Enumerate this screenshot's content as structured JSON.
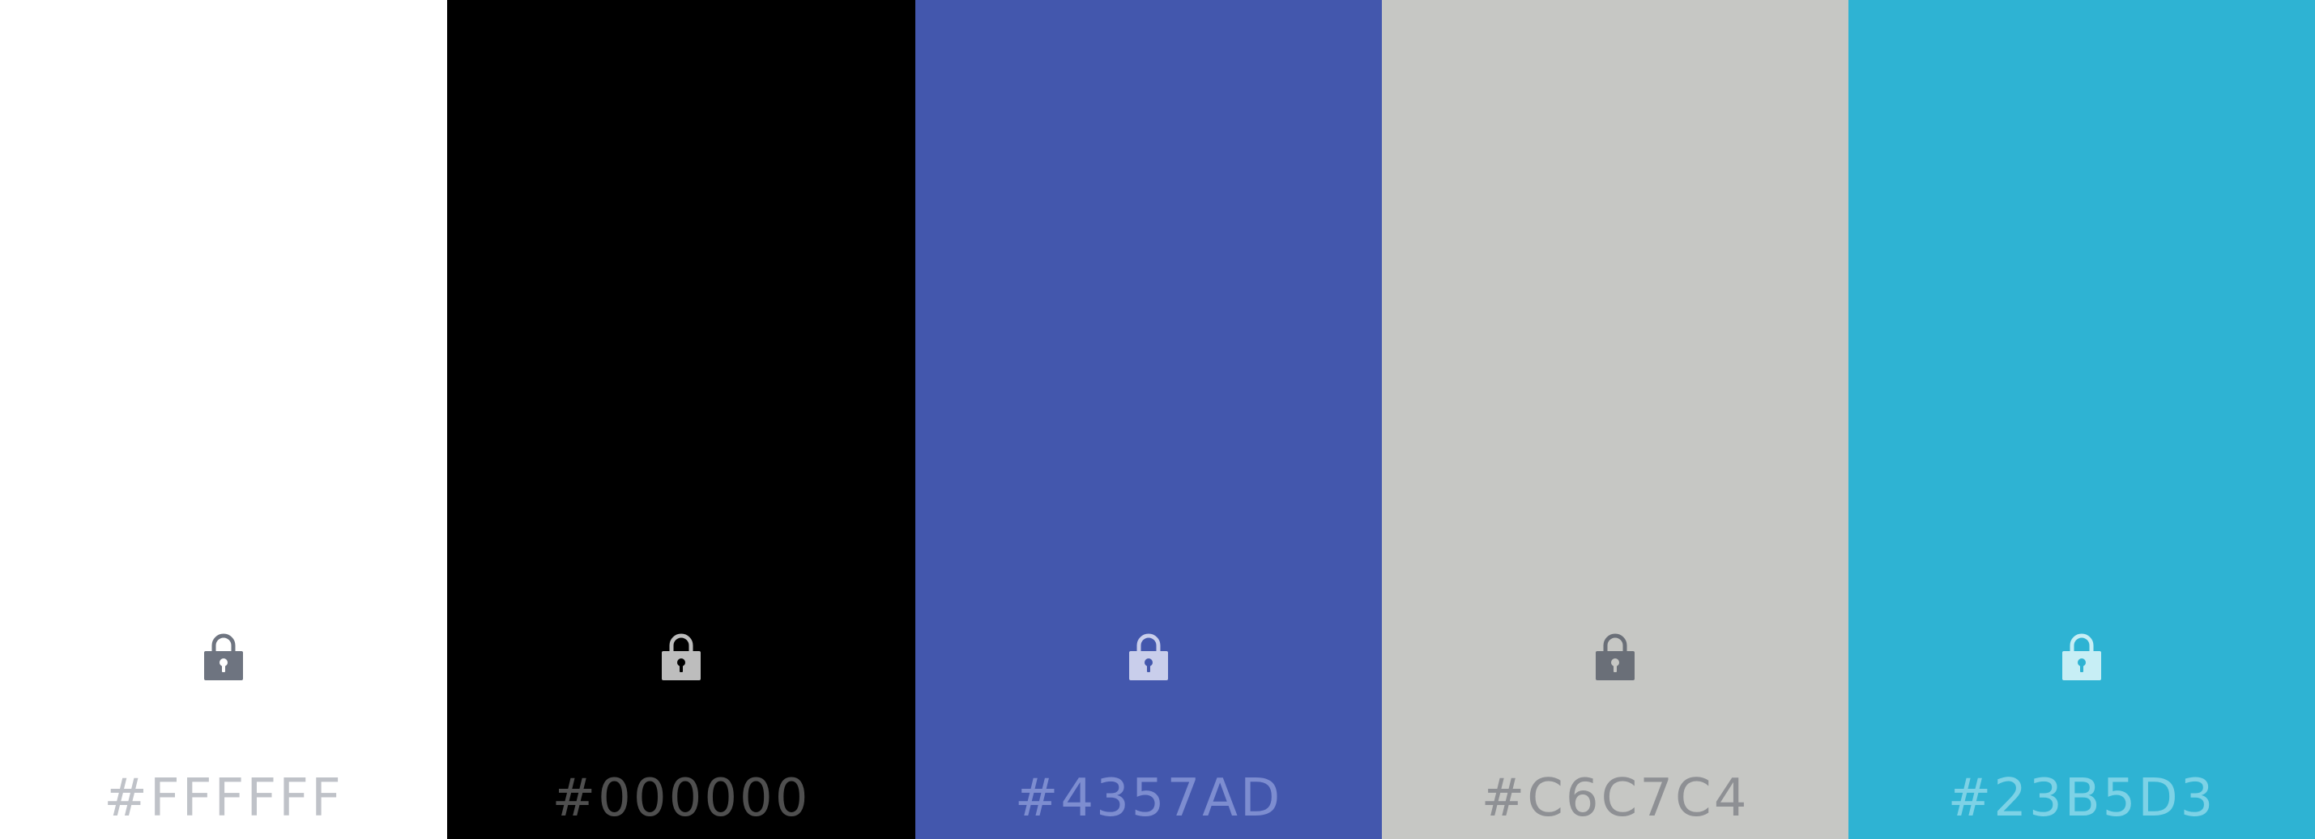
{
  "swatches": [
    {
      "hex_label": "#FFFFFF",
      "color": "#FFFFFF",
      "lock_color": "#6E7480",
      "keyhole_color": "#FFFFFF",
      "label_color": "#BFC2C8",
      "locked": true,
      "lock_icon": "lock-icon"
    },
    {
      "hex_label": "#000000",
      "color": "#000000",
      "lock_color": "#BDBDBD",
      "keyhole_color": "#000000",
      "label_color": "#4F4F4F",
      "locked": true,
      "lock_icon": "lock-icon"
    },
    {
      "hex_label": "#4357AD",
      "color": "#4357AD",
      "lock_color": "#C9CEEB",
      "keyhole_color": "#4357AD",
      "label_color": "#7D8DD0",
      "locked": true,
      "lock_icon": "lock-icon"
    },
    {
      "hex_label": "#C6C7C4",
      "color": "#C6C7C4",
      "lock_color": "#6A6F78",
      "keyhole_color": "#C6C7C4",
      "label_color": "#8E9094",
      "locked": true,
      "lock_icon": "lock-icon"
    },
    {
      "hex_label": "#23B5D3",
      "color": "#2EB3D3",
      "lock_color": "#C7EEF5",
      "keyhole_color": "#2EB3D3",
      "label_color": "#7DD2E6",
      "locked": true,
      "lock_icon": "lock-icon"
    }
  ]
}
